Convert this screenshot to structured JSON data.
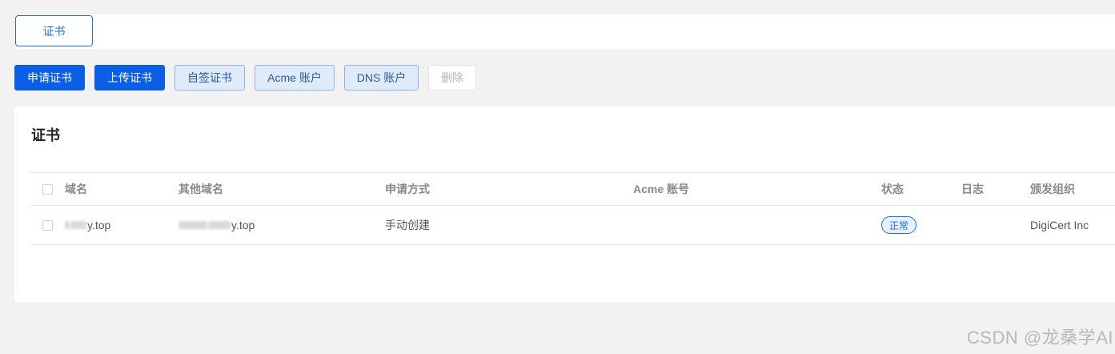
{
  "tabs": [
    {
      "label": "证书"
    }
  ],
  "toolbar": {
    "apply_label": "申请证书",
    "upload_label": "上传证书",
    "selfsign_label": "自签证书",
    "acme_label": "Acme 账户",
    "dns_label": "DNS 账户",
    "delete_label": "删除"
  },
  "card": {
    "title": "证书"
  },
  "table": {
    "columns": [
      "域名",
      "其他域名",
      "申请方式",
      "Acme 账号",
      "状态",
      "日志",
      "颁发组织"
    ],
    "rows": [
      {
        "domain": "y.top",
        "other_domains": "y.top",
        "method": "手动创建",
        "acme_account": "",
        "status": "正常",
        "log": "",
        "issuer": "DigiCert Inc"
      }
    ]
  },
  "watermark": "CSDN @龙桑学AI",
  "colors": {
    "primary": "#0a5fe6",
    "accent": "#1e6fd9",
    "page_bg": "#f2f2f2"
  }
}
